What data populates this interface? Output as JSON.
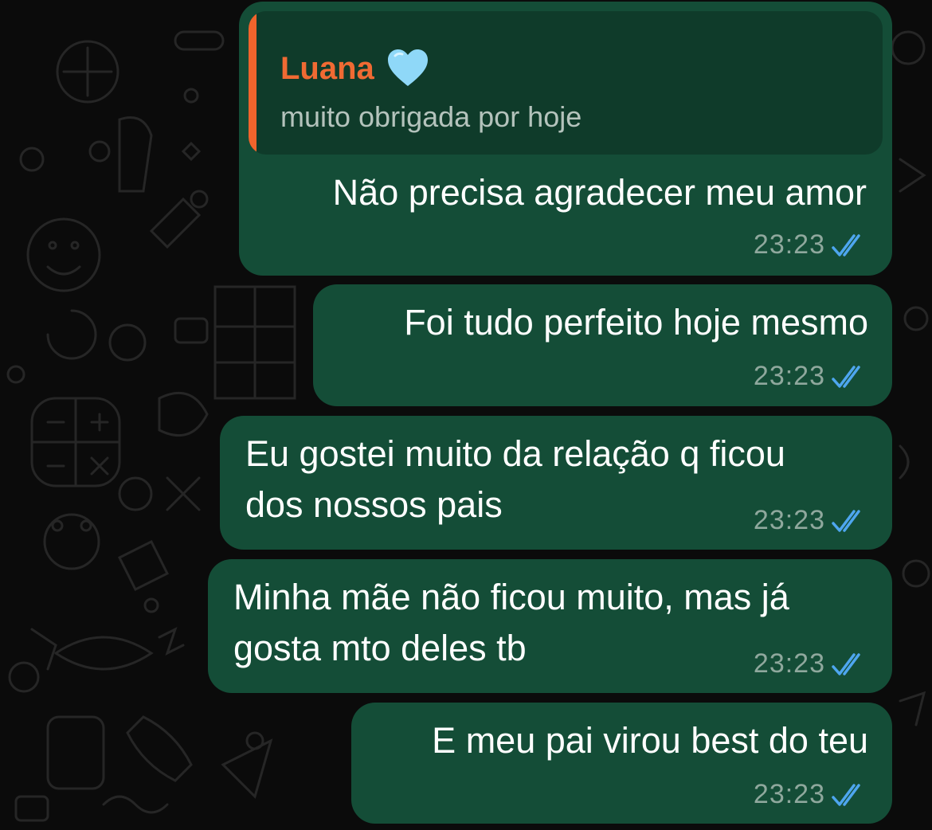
{
  "colors": {
    "background": "#0b0b0b",
    "bubble": "#144d37",
    "reply_box": "#0f3b2a",
    "reply_accent": "#f06a33",
    "time": "#8fa89d",
    "read_ticks": "#4ea6ef"
  },
  "icons": {
    "heart": "light-blue-heart-emoji",
    "status": "double-check-read-icon"
  },
  "reply": {
    "author": "Luana",
    "text": "muito obrigada por hoje"
  },
  "messages": [
    {
      "text": "Não precisa agradecer meu amor",
      "time": "23:23",
      "status": "read"
    },
    {
      "text": "Foi tudo perfeito hoje mesmo",
      "time": "23:23",
      "status": "read"
    },
    {
      "line1": "Eu gostei muito da relação q ficou",
      "line2": "dos nossos pais",
      "time": "23:23",
      "status": "read"
    },
    {
      "line1": "Minha mãe não ficou muito, mas já",
      "line2": "gosta mto deles tb",
      "time": "23:23",
      "status": "read"
    },
    {
      "text": "E meu pai virou best do teu",
      "time": "23:23",
      "status": "read"
    }
  ]
}
